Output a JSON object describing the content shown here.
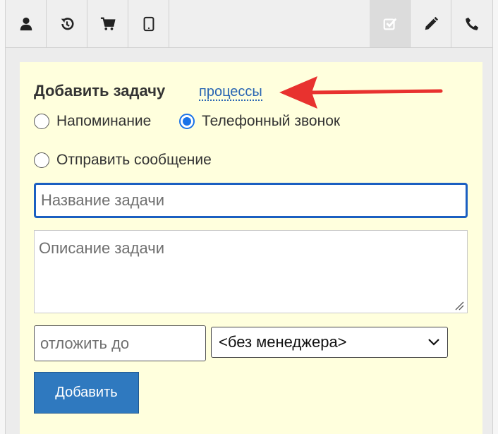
{
  "toolbar": {
    "buttons": [
      {
        "icon": "user-icon",
        "active": false
      },
      {
        "icon": "history-icon",
        "active": false
      },
      {
        "icon": "cart-icon",
        "active": false
      },
      {
        "icon": "tablet-icon",
        "active": false
      },
      {
        "icon": "task-check-icon",
        "active": true
      },
      {
        "icon": "pencil-icon",
        "active": false
      },
      {
        "icon": "phone-icon",
        "active": false
      }
    ]
  },
  "form": {
    "title": "Добавить задачу",
    "processes_link": "процессы",
    "radios": [
      {
        "label": "Напоминание",
        "checked": false
      },
      {
        "label": "Телефонный звонок",
        "checked": true
      },
      {
        "label": "Отправить сообщение",
        "checked": false
      }
    ],
    "task_name_placeholder": "Название задачи",
    "task_description_placeholder": "Описание задачи",
    "defer_until_placeholder": "отложить до",
    "manager_select_value": "<без менеджера>",
    "add_button_label": "Добавить"
  },
  "colors": {
    "panel_bg": "#ffffdd",
    "accent_blue": "#1b5fc1",
    "button_blue": "#2f79bf",
    "annotation_arrow": "#e8322f"
  }
}
